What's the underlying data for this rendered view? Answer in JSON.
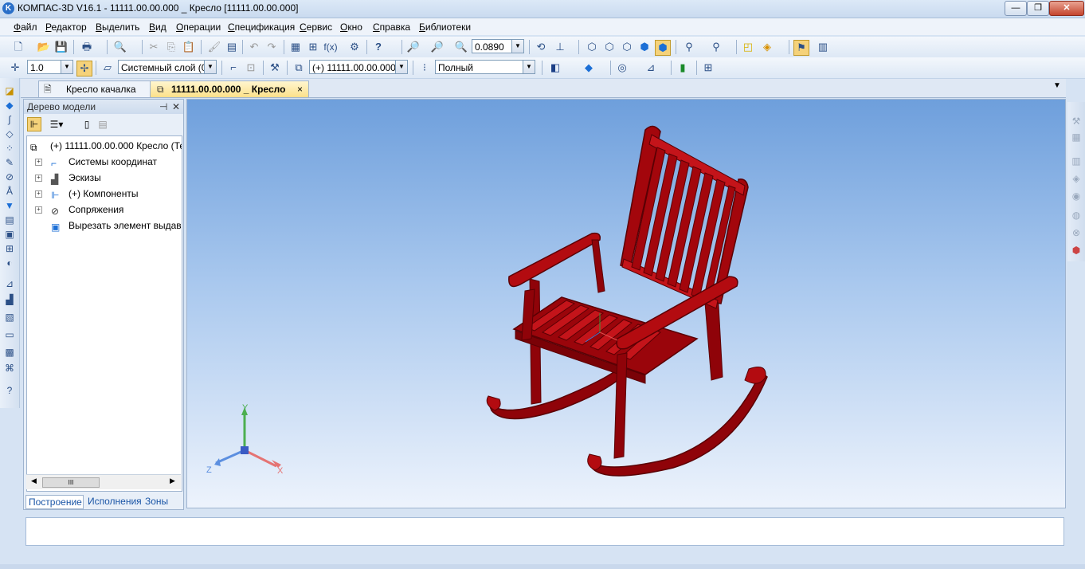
{
  "window": {
    "title": "КОМПАС-3D V16.1 - 11111.00.00.000 _ Кресло [11111.00.00.000]",
    "app_icon_letter": "K",
    "minimize": "—",
    "maximize": "❐",
    "close": "✕"
  },
  "menu": [
    "Файл",
    "Редактор",
    "Выделить",
    "Вид",
    "Операции",
    "Спецификация",
    "Сервис",
    "Окно",
    "Справка",
    "Библиотеки"
  ],
  "toolbar1": {
    "zoom_value": "0.0890"
  },
  "toolbar2": {
    "step_value": "1.0",
    "layer_value": "Системный слой (0)",
    "component_value": "(+) 11111.00.00.000",
    "display_mode_value": "Полный"
  },
  "tabs": [
    {
      "label": "Кресло качалка"
    },
    {
      "label": "11111.00.00.000 _ Кресло",
      "close": "×"
    }
  ],
  "tree": {
    "title": "Дерево модели",
    "pin": "⊣",
    "close": "✕",
    "root": "(+) 11111.00.00.000 Кресло (Те",
    "items": [
      {
        "label": "Системы координат"
      },
      {
        "label": "Эскизы"
      },
      {
        "label": "(+) Компоненты"
      },
      {
        "label": "Сопряжения"
      },
      {
        "label": "Вырезать элемент выдав."
      }
    ],
    "bottom_tabs": [
      "Построение",
      "Исполнения",
      "Зоны"
    ],
    "scroll_thumb": "III"
  },
  "axes": {
    "x": "X",
    "y": "Y",
    "z": "Z"
  },
  "colors": {
    "chair": "#a3060c",
    "chair_dark": "#6d0206",
    "chair_light": "#c4141a",
    "viewport_top": "#6e9fdc",
    "viewport_bottom": "#edf3fc"
  },
  "statusbar_text": ""
}
